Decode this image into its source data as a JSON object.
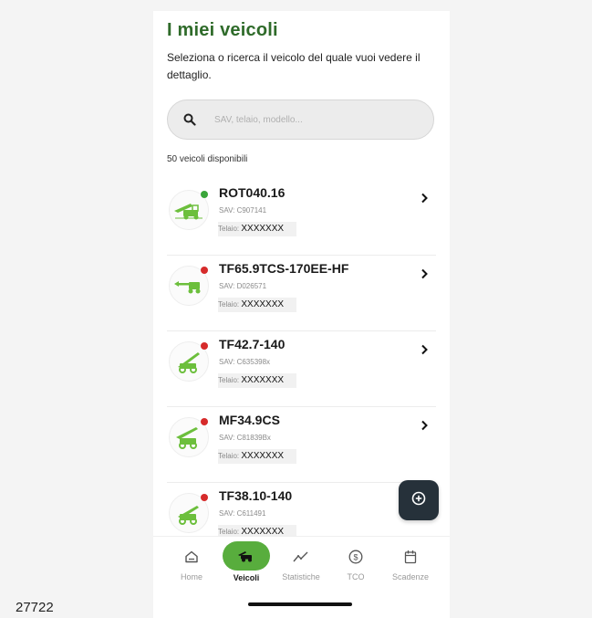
{
  "page": {
    "title": "I miei veicoli",
    "subtitle": "Seleziona o ricerca il veicolo del quale vuoi vedere il dettaglio."
  },
  "search": {
    "placeholder": "SAV, telaio, modello...",
    "value": ""
  },
  "vehicles_count": "50 veicoli disponibili",
  "vehicles": [
    {
      "model": "ROT040.16",
      "sav": "SAV: C907141",
      "chassis_label": "Telaio:",
      "chassis_value": "XXXXXXX",
      "status_color": "#3aa53a",
      "icon": "rotating-telehandler-icon"
    },
    {
      "model": "TF65.9TCS-170EE-HF",
      "sav": "SAV: D026571",
      "chassis_label": "Telaio:",
      "chassis_value": "XXXXXXX",
      "status_color": "#d62b2b",
      "icon": "telehandler-icon"
    },
    {
      "model": "TF42.7-140",
      "sav": "SAV: C635398x",
      "chassis_label": "Telaio:",
      "chassis_value": "XXXXXXX",
      "status_color": "#d62b2b",
      "icon": "telehandler-icon"
    },
    {
      "model": "MF34.9CS",
      "sav": "SAV: C81839Bx",
      "chassis_label": "Telaio:",
      "chassis_value": "XXXXXXX",
      "status_color": "#d62b2b",
      "icon": "telehandler-icon"
    },
    {
      "model": "TF38.10-140",
      "sav": "SAV: C611491",
      "chassis_label": "Telaio:",
      "chassis_value": "XXXXXXX",
      "status_color": "#d62b2b",
      "icon": "telehandler-icon"
    }
  ],
  "fab": {
    "icon": "plus-circle-icon"
  },
  "tabbar": {
    "tabs": [
      {
        "label": "Home",
        "icon": "home-icon",
        "active": false
      },
      {
        "label": "Veicoli",
        "icon": "vehicle-icon",
        "active": true
      },
      {
        "label": "Statistiche",
        "icon": "statistics-icon",
        "active": false
      },
      {
        "label": "TCO",
        "icon": "dollar-icon",
        "active": false
      },
      {
        "label": "Scadenze",
        "icon": "calendar-icon",
        "active": false
      }
    ]
  },
  "figure_number": "27722",
  "colors": {
    "brand_green": "#2f6b2a",
    "active_tab": "#58ad3d",
    "status_ok": "#3aa53a",
    "status_alert": "#d62b2b",
    "fab_bg": "#26313a"
  }
}
